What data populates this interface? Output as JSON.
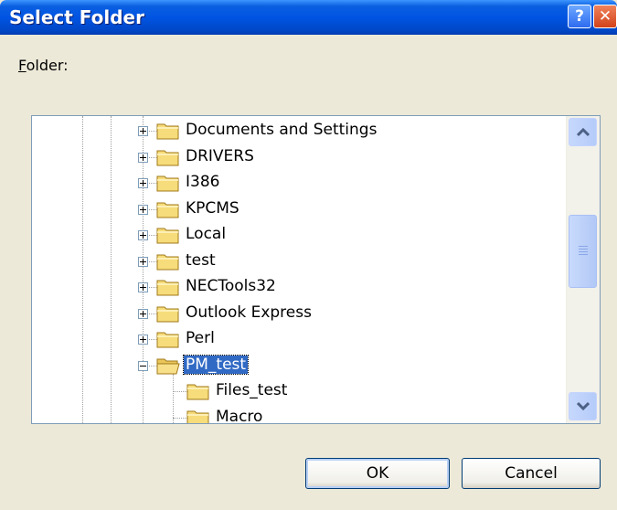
{
  "window": {
    "title": "Select Folder"
  },
  "title_buttons": {
    "help_glyph": "?",
    "close_glyph": "✕"
  },
  "folder_label": {
    "mnemonic": "F",
    "rest": "older:"
  },
  "tree": {
    "items": [
      {
        "label": "Documents and Settings",
        "expander": "plus",
        "selected": false
      },
      {
        "label": "DRIVERS",
        "expander": "plus",
        "selected": false
      },
      {
        "label": "I386",
        "expander": "plus",
        "selected": false
      },
      {
        "label": "KPCMS",
        "expander": "plus",
        "selected": false
      },
      {
        "label": "Local",
        "expander": "plus",
        "selected": false
      },
      {
        "label": "test",
        "expander": "plus",
        "selected": false
      },
      {
        "label": "NECTools32",
        "expander": "plus",
        "selected": false
      },
      {
        "label": "Outlook Express",
        "expander": "plus",
        "selected": false
      },
      {
        "label": "Perl",
        "expander": "plus",
        "selected": false
      },
      {
        "label": "PM_test",
        "expander": "minus",
        "selected": true
      },
      {
        "label": "Files_test",
        "expander": "none",
        "selected": false
      },
      {
        "label": "Macro",
        "expander": "none",
        "selected": false
      }
    ]
  },
  "buttons": {
    "ok": "OK",
    "cancel": "Cancel"
  },
  "colors": {
    "title_bar": "#0054e3",
    "selection": "#316ac5",
    "folder": "#f6dc7a",
    "dialog_bg": "#ece9d8"
  }
}
